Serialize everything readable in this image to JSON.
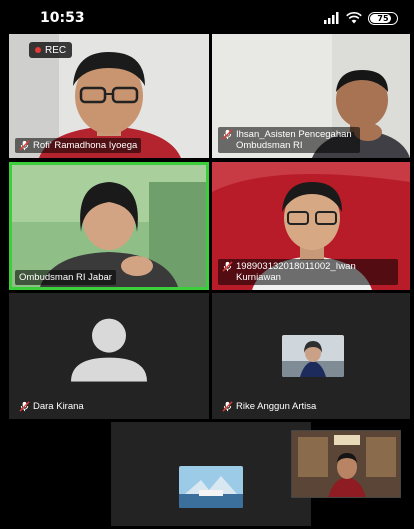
{
  "status_bar": {
    "time": "10:53",
    "battery": "75",
    "icons": [
      "signal-icon",
      "wifi-icon",
      "battery-icon"
    ]
  },
  "recording": {
    "label": "REC",
    "color": "#e53935"
  },
  "colors": {
    "active_speaker": "#3ccf3c",
    "tile_bg": "#232323",
    "background": "#000000"
  },
  "participants": [
    {
      "name": "Rofi' Ramadhona Iyoega",
      "mic": "muted"
    },
    {
      "name": "Ihsan_Asisten Pencegahan Ombudsman RI",
      "mic": "muted"
    },
    {
      "name": "Ombudsman RI Jabar",
      "mic": "on",
      "active_speaker": true
    },
    {
      "name": "198903132018011002_Iwan Kurniawan",
      "mic": "muted"
    },
    {
      "name": "Dara Kirana",
      "mic": "muted"
    },
    {
      "name": "Rike Anggun Artisa",
      "mic": "muted"
    }
  ]
}
